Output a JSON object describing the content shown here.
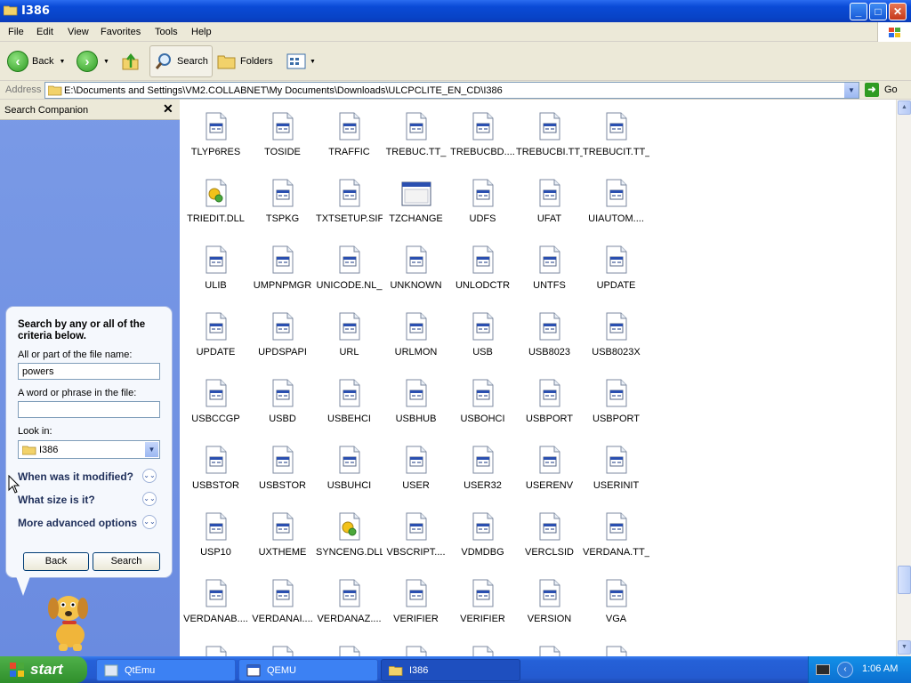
{
  "window": {
    "title": "I386",
    "controls": {
      "minimize": "_",
      "maximize": "□",
      "close": "✕"
    }
  },
  "menu": [
    "File",
    "Edit",
    "View",
    "Favorites",
    "Tools",
    "Help"
  ],
  "toolbar": {
    "back_label": "Back",
    "search_label": "Search",
    "folders_label": "Folders"
  },
  "address": {
    "label": "Address",
    "path": "E:\\Documents and Settings\\VM2.COLLABNET\\My Documents\\Downloads\\ULCPCLITE_EN_CD\\I386",
    "go_label": "Go"
  },
  "search_companion": {
    "title": "Search Companion",
    "close": "✕",
    "intro": "Search by any or all of the criteria below.",
    "filename_label": "All or part of the file name:",
    "filename_value": "powers",
    "phrase_label": "A word or phrase in the file:",
    "phrase_value": "",
    "lookin_label": "Look in:",
    "lookin_value": "I386",
    "options": [
      {
        "label": "When was it modified?"
      },
      {
        "label": "What size is it?"
      },
      {
        "label": "More advanced options"
      }
    ],
    "back_button": "Back",
    "search_button": "Search"
  },
  "files": [
    {
      "name": "TLYP6RES",
      "icon": "file-icon"
    },
    {
      "name": "TOSIDE",
      "icon": "file-icon"
    },
    {
      "name": "TRAFFIC",
      "icon": "file-icon"
    },
    {
      "name": "TREBUC.TT_",
      "icon": "file-icon"
    },
    {
      "name": "TREBUCBD....",
      "icon": "file-icon"
    },
    {
      "name": "TREBUCBI.TT_",
      "icon": "file-icon"
    },
    {
      "name": "TREBUCIT.TT_",
      "icon": "file-icon"
    },
    {
      "name": "TRIEDIT.DLL",
      "icon": "dll-icon"
    },
    {
      "name": "TSPKG",
      "icon": "file-icon"
    },
    {
      "name": "TXTSETUP.SIF",
      "icon": "file-icon"
    },
    {
      "name": "TZCHANGE",
      "icon": "window-app-icon"
    },
    {
      "name": "UDFS",
      "icon": "file-icon"
    },
    {
      "name": "UFAT",
      "icon": "file-icon"
    },
    {
      "name": "UIAUTOM....",
      "icon": "file-icon"
    },
    {
      "name": "ULIB",
      "icon": "file-icon"
    },
    {
      "name": "UMPNPMGR",
      "icon": "file-icon"
    },
    {
      "name": "UNICODE.NL_",
      "icon": "file-icon"
    },
    {
      "name": "UNKNOWN",
      "icon": "file-icon"
    },
    {
      "name": "UNLODCTR",
      "icon": "file-icon"
    },
    {
      "name": "UNTFS",
      "icon": "file-icon"
    },
    {
      "name": "UPDATE",
      "icon": "file-icon"
    },
    {
      "name": "UPDATE",
      "icon": "file-icon"
    },
    {
      "name": "UPDSPAPI",
      "icon": "file-icon"
    },
    {
      "name": "URL",
      "icon": "file-icon"
    },
    {
      "name": "URLMON",
      "icon": "file-icon"
    },
    {
      "name": "USB",
      "icon": "file-icon"
    },
    {
      "name": "USB8023",
      "icon": "file-icon"
    },
    {
      "name": "USB8023X",
      "icon": "file-icon"
    },
    {
      "name": "USBCCGP",
      "icon": "file-icon"
    },
    {
      "name": "USBD",
      "icon": "file-icon"
    },
    {
      "name": "USBEHCI",
      "icon": "file-icon"
    },
    {
      "name": "USBHUB",
      "icon": "file-icon"
    },
    {
      "name": "USBOHCI",
      "icon": "file-icon"
    },
    {
      "name": "USBPORT",
      "icon": "file-icon"
    },
    {
      "name": "USBPORT",
      "icon": "file-icon"
    },
    {
      "name": "USBSTOR",
      "icon": "file-icon"
    },
    {
      "name": "USBSTOR",
      "icon": "file-icon"
    },
    {
      "name": "USBUHCI",
      "icon": "file-icon"
    },
    {
      "name": "USER",
      "icon": "file-icon"
    },
    {
      "name": "USER32",
      "icon": "file-icon"
    },
    {
      "name": "USERENV",
      "icon": "file-icon"
    },
    {
      "name": "USERINIT",
      "icon": "file-icon"
    },
    {
      "name": "USP10",
      "icon": "file-icon"
    },
    {
      "name": "UXTHEME",
      "icon": "file-icon"
    },
    {
      "name": "SYNCENG.DLL",
      "icon": "dll-icon"
    },
    {
      "name": "VBSCRIPT....",
      "icon": "file-icon"
    },
    {
      "name": "VDMDBG",
      "icon": "file-icon"
    },
    {
      "name": "VERCLSID",
      "icon": "file-icon"
    },
    {
      "name": "VERDANA.TT_",
      "icon": "file-icon"
    },
    {
      "name": "VERDANAB....",
      "icon": "file-icon"
    },
    {
      "name": "VERDANAI....",
      "icon": "file-icon"
    },
    {
      "name": "VERDANAZ....",
      "icon": "file-icon"
    },
    {
      "name": "VERIFIER",
      "icon": "file-icon"
    },
    {
      "name": "VERIFIER",
      "icon": "file-icon"
    },
    {
      "name": "VERSION",
      "icon": "file-icon"
    },
    {
      "name": "VGA",
      "icon": "file-icon"
    },
    {
      "name": "",
      "icon": "file-icon"
    },
    {
      "name": "",
      "icon": "file-icon"
    },
    {
      "name": "",
      "icon": "file-icon"
    },
    {
      "name": "",
      "icon": "file-icon"
    },
    {
      "name": "",
      "icon": "file-icon"
    },
    {
      "name": "",
      "icon": "file-icon"
    },
    {
      "name": "",
      "icon": "file-icon"
    }
  ],
  "taskbar": {
    "start_label": "start",
    "tasks": [
      {
        "label": "QtEmu"
      },
      {
        "label": "QEMU"
      },
      {
        "label": "I386"
      }
    ],
    "clock": "1:06 AM"
  },
  "colors": {
    "titlebar": "#0a4ad6",
    "sidebar": "#6a8be0",
    "taskbar": "#245ad0",
    "start": "#3c9a36"
  }
}
